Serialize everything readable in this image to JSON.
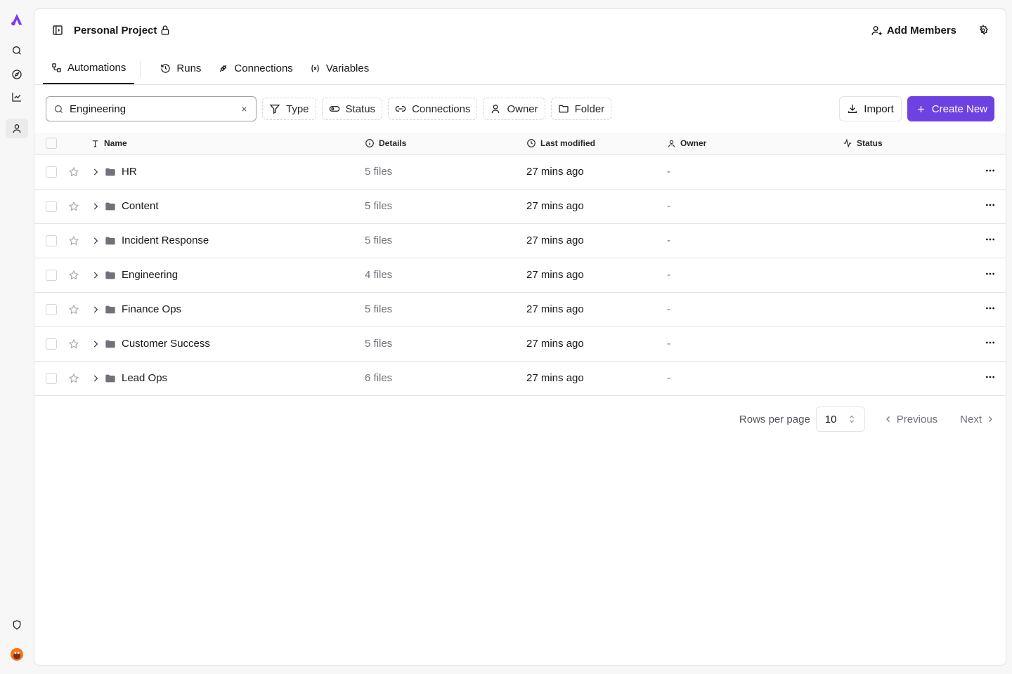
{
  "header": {
    "project_title": "Personal Project",
    "add_members_label": "Add Members"
  },
  "tabs": [
    {
      "label": "Automations",
      "icon": "automations-icon",
      "active": true
    },
    {
      "label": "Runs",
      "icon": "history-icon",
      "active": false
    },
    {
      "label": "Connections",
      "icon": "plug-icon",
      "active": false
    },
    {
      "label": "Variables",
      "icon": "variable-icon",
      "active": false
    }
  ],
  "toolbar": {
    "search_value": "Engineering",
    "filters": [
      "Type",
      "Status",
      "Connections",
      "Owner",
      "Folder"
    ],
    "import_label": "Import",
    "create_label": "Create New"
  },
  "table": {
    "columns": [
      "Name",
      "Details",
      "Last modified",
      "Owner",
      "Status"
    ],
    "rows": [
      {
        "name": "HR",
        "details": "5 files",
        "modified": "27 mins ago",
        "owner": "-"
      },
      {
        "name": "Content",
        "details": "5 files",
        "modified": "27 mins ago",
        "owner": "-"
      },
      {
        "name": "Incident Response",
        "details": "5 files",
        "modified": "27 mins ago",
        "owner": "-"
      },
      {
        "name": "Engineering",
        "details": "4 files",
        "modified": "27 mins ago",
        "owner": "-"
      },
      {
        "name": "Finance Ops",
        "details": "5 files",
        "modified": "27 mins ago",
        "owner": "-"
      },
      {
        "name": "Customer Success",
        "details": "5 files",
        "modified": "27 mins ago",
        "owner": "-"
      },
      {
        "name": "Lead Ops",
        "details": "6 files",
        "modified": "27 mins ago",
        "owner": "-"
      }
    ]
  },
  "pagination": {
    "rows_per_page_label": "Rows per page",
    "rows_per_page_value": "10",
    "previous_label": "Previous",
    "next_label": "Next"
  },
  "colors": {
    "accent": "#6e41e2",
    "logo": "#7c3aed"
  }
}
